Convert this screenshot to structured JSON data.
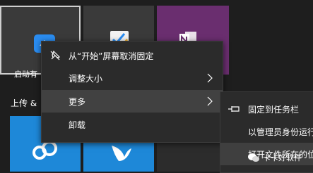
{
  "tiles": {
    "top": [
      {
        "label": "启动有",
        "icon": "app-arrow-icon"
      },
      {
        "label": "",
        "icon": "checklist-icon"
      },
      {
        "label": "",
        "icon": "onenote-icon"
      }
    ],
    "section_title": "上传 &",
    "bottom": [
      {
        "icon": "cloud-drive-icon"
      },
      {
        "icon": "bird-app-icon"
      },
      {
        "icon": "software-box-icon"
      }
    ]
  },
  "context_menu": {
    "items": [
      {
        "label": "从“开始”屏幕取消固定",
        "icon": "unpin-icon",
        "has_submenu": false
      },
      {
        "label": "调整大小",
        "has_submenu": true
      },
      {
        "label": "更多",
        "has_submenu": true,
        "highlighted": true
      },
      {
        "label": "卸载",
        "has_submenu": false
      }
    ]
  },
  "submenu": {
    "items": [
      {
        "label": "固定到任务栏",
        "icon": "pin-icon"
      },
      {
        "label": "以管理员身份运行",
        "icon": ""
      },
      {
        "label": "打开文件所在的位",
        "icon": ""
      }
    ]
  },
  "watermark": {
    "text": "卡卡好软件"
  },
  "colors": {
    "purple_tile": "#6a2e6f",
    "blue_tile": "#1e88d8",
    "menu_bg": "#2b2b2b",
    "highlight": "#414141"
  }
}
